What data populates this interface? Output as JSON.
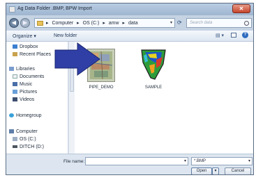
{
  "window": {
    "title": "Ag Data Folder .BMP, BPW Import",
    "close_glyph": "✕"
  },
  "address_bar": {
    "breadcrumb": [
      "Computer",
      "OS (C:)",
      "amw",
      "data"
    ],
    "separator": "▸",
    "search_placeholder": "Search data"
  },
  "toolbar": {
    "organize_label": "Organize ▾",
    "new_folder_label": "New folder"
  },
  "nav_pane": {
    "items": [
      {
        "label": "Dropbox",
        "icon": "dropbox-icon"
      },
      {
        "label": "Recent Places",
        "icon": "recent-places-icon"
      },
      {
        "label": "Libraries",
        "icon": "libraries-icon"
      },
      {
        "label": "Documents",
        "icon": "documents-icon"
      },
      {
        "label": "Music",
        "icon": "music-icon"
      },
      {
        "label": "Pictures",
        "icon": "pictures-icon"
      },
      {
        "label": "Videos",
        "icon": "videos-icon"
      },
      {
        "label": "Homegroup",
        "icon": "homegroup-icon"
      },
      {
        "label": "Computer",
        "icon": "computer-icon"
      },
      {
        "label": "OS (C:)",
        "icon": "drive-icon"
      },
      {
        "label": "DITCH (D:)",
        "icon": "drive-icon"
      }
    ]
  },
  "files": [
    {
      "name": "PIPE_DEMO",
      "icon": "map-thumbnail-icon"
    },
    {
      "name": "SAMPLE",
      "icon": "field-map-thumbnail-icon"
    }
  ],
  "bottom": {
    "file_name_label": "File name:",
    "file_name_value": "",
    "filter_value": "*.BMP",
    "open_label": "Open",
    "cancel_label": "Cancel"
  },
  "colors": {
    "arrow": "#2f3fa6",
    "dialog_bg": "#cfd9e6",
    "close_button": "#c6452c"
  }
}
